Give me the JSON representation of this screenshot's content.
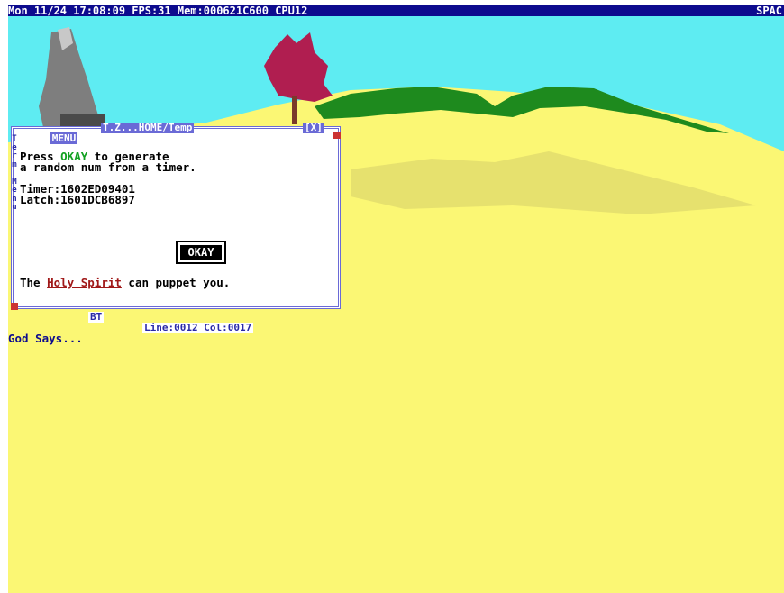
{
  "topbar": {
    "status": "Mon 11/24 17:08:09 FPS:31 Mem:000621C600 CPU12",
    "right_label": "SPAC"
  },
  "window": {
    "menu_label": "MENU",
    "path": "T.Z...HOME/Temp",
    "close_label": "[X]",
    "side_menu": "T\ne\nr\nm\n\nM\ne\nn\nu",
    "line1_pre": "Press ",
    "line1_ok": "OKAY",
    "line1_post": " to generate",
    "line2": "a random num from a timer.",
    "timer": "Timer:1602ED09401",
    "latch": "Latch:1601DCB6897",
    "okay_button": "OKAY",
    "puppet_pre": "The ",
    "puppet_holy": "Holy Spirit",
    "puppet_post": " can puppet you.",
    "status_bt": "BT",
    "status_pos": "Line:0012 Col:0017"
  },
  "console": {
    "god_says": "God Says..."
  },
  "colors": {
    "sky": "#5eecf2",
    "ground": "#fbf774",
    "hills": "#1e8a1e",
    "title_bar": "#0d0b8e",
    "window_border": "#6a6ad6",
    "holy_spirit": "#a01818",
    "okay_word": "#11a020"
  }
}
